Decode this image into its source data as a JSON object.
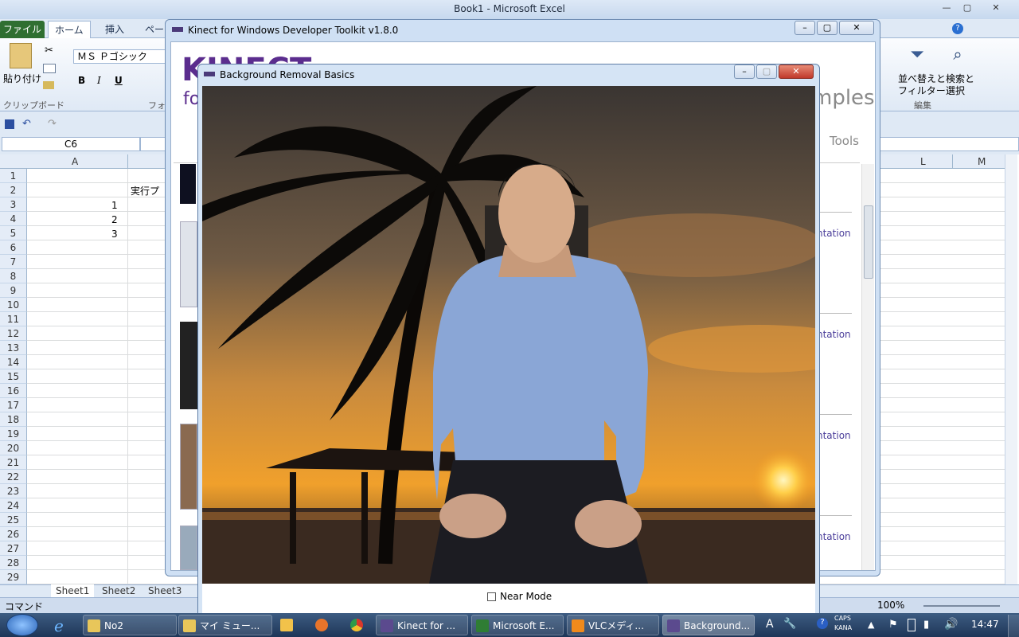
{
  "excel": {
    "title": "Book1 - Microsoft Excel",
    "tabs": [
      "ファイル",
      "ホーム",
      "挿入",
      "ペー"
    ],
    "ribbon": {
      "paste": "貼り付け",
      "clipboard": "クリップボード",
      "font_name": "ＭＳ Ｐゴシック",
      "font_group": "フォン",
      "sort_filter": "並べ替えと",
      "filter": "フィルター",
      "find": "検索と",
      "select": "選択",
      "edit_group": "編集",
      "bold": "B",
      "italic": "I",
      "underline": "U"
    },
    "name_box": "C6",
    "columns": {
      "a": "A",
      "l": "L",
      "m": "M"
    },
    "rows": [
      "1",
      "2",
      "3",
      "4",
      "5",
      "6",
      "7",
      "8",
      "9",
      "10",
      "11",
      "12",
      "13",
      "14",
      "15",
      "16",
      "17",
      "18",
      "19",
      "20",
      "21",
      "22",
      "23",
      "24",
      "25",
      "26",
      "27",
      "28",
      "29"
    ],
    "cells": {
      "b2": "実行プ",
      "a3": "1",
      "a4": "2",
      "a5": "3"
    },
    "sheets": [
      "Sheet1",
      "Sheet2",
      "Sheet3"
    ],
    "status_mode": "コマンド",
    "zoom": "100%"
  },
  "toolkit": {
    "title": "Kinect for Windows Developer Toolkit v1.8.0",
    "logo": "KINECT",
    "logo_sub": "fo",
    "heading_tail": "mples",
    "tools_tab": "Tools",
    "link_labels": [
      "ntation",
      "ntation",
      "ntation",
      "ntation"
    ]
  },
  "bg_removal": {
    "title": "Background Removal Basics",
    "near_mode_label": "Near Mode",
    "near_mode_checked": false
  },
  "taskbar": {
    "items": [
      "No2",
      "マイ ミュー...",
      "Kinect for ...",
      "Microsoft E...",
      "VLCメディ...",
      "Background..."
    ],
    "clock": "14:47",
    "caps": "CAPS",
    "kana": "KANA"
  },
  "colors": {
    "excel_green": "#2f6f31",
    "kinect_purple": "#5b2d8e",
    "taskbar": "#1e3658"
  }
}
